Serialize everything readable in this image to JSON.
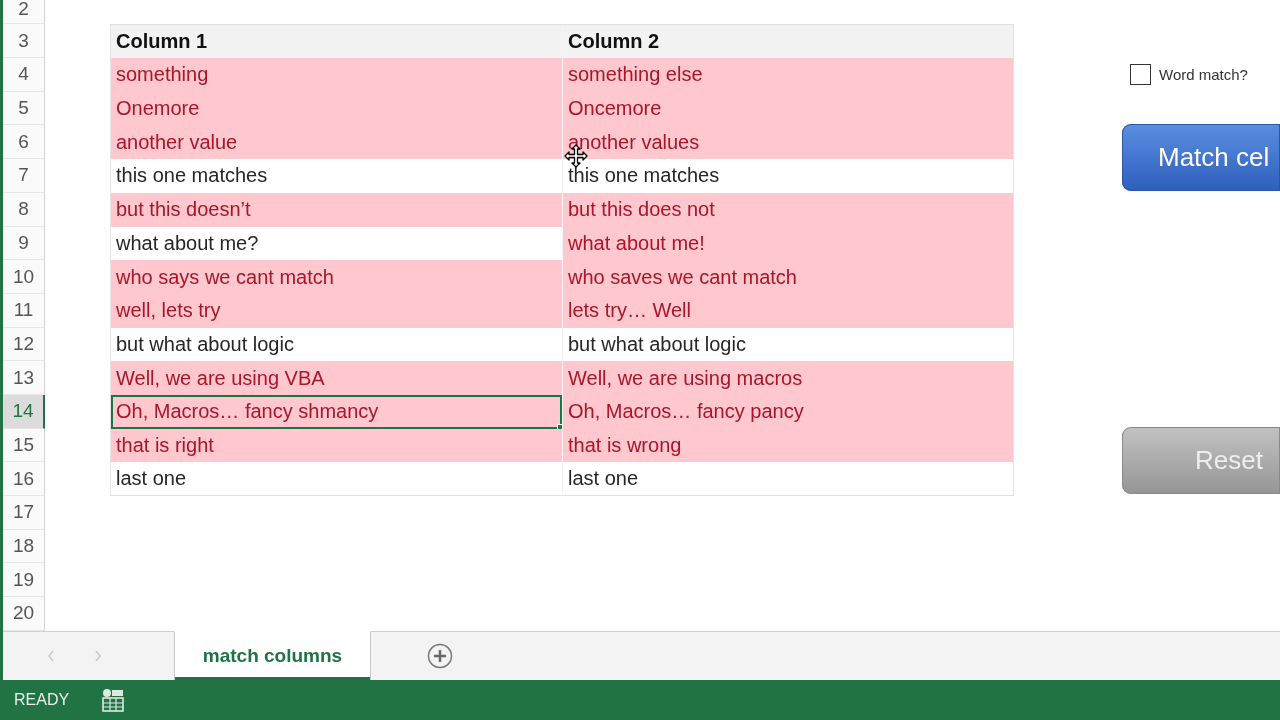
{
  "sheet": {
    "rows": [
      {
        "number": "2",
        "kind": "empty"
      },
      {
        "number": "3",
        "kind": "header",
        "cells": [
          {
            "text": "Column 1",
            "selected": false
          },
          {
            "text": "Column 2",
            "selected": false
          }
        ]
      },
      {
        "number": "4",
        "kind": "data",
        "cells": [
          {
            "text": "something",
            "highlighted": true,
            "selected": false
          },
          {
            "text": "something else",
            "highlighted": true,
            "selected": false
          }
        ]
      },
      {
        "number": "5",
        "kind": "data",
        "cells": [
          {
            "text": "Onemore",
            "highlighted": true,
            "selected": false
          },
          {
            "text": "Oncemore",
            "highlighted": true,
            "selected": false
          }
        ]
      },
      {
        "number": "6",
        "kind": "data",
        "cells": [
          {
            "text": "another value",
            "highlighted": true,
            "selected": false
          },
          {
            "text": "another values",
            "highlighted": true,
            "selected": false
          }
        ]
      },
      {
        "number": "7",
        "kind": "data",
        "cells": [
          {
            "text": "this one matches",
            "highlighted": false,
            "selected": false
          },
          {
            "text": "this one matches",
            "highlighted": false,
            "selected": false
          }
        ]
      },
      {
        "number": "8",
        "kind": "data",
        "cells": [
          {
            "text": "but this doesn’t",
            "highlighted": true,
            "selected": false
          },
          {
            "text": "but this does not",
            "highlighted": true,
            "selected": false
          }
        ]
      },
      {
        "number": "9",
        "kind": "data",
        "cells": [
          {
            "text": "what about me?",
            "highlighted": false,
            "selected": false
          },
          {
            "text": "what about me!",
            "highlighted": true,
            "selected": false
          }
        ]
      },
      {
        "number": "10",
        "kind": "data",
        "cells": [
          {
            "text": "who says we cant match",
            "highlighted": true,
            "selected": false
          },
          {
            "text": "who saves we cant match",
            "highlighted": true,
            "selected": false
          }
        ]
      },
      {
        "number": "11",
        "kind": "data",
        "cells": [
          {
            "text": "well, lets try",
            "highlighted": true,
            "selected": false
          },
          {
            "text": "lets try… Well",
            "highlighted": true,
            "selected": false
          }
        ]
      },
      {
        "number": "12",
        "kind": "data",
        "cells": [
          {
            "text": "but what about logic",
            "highlighted": false,
            "selected": false
          },
          {
            "text": "but what about logic",
            "highlighted": false,
            "selected": false
          }
        ]
      },
      {
        "number": "13",
        "kind": "data",
        "cells": [
          {
            "text": "Well, we are using VBA",
            "highlighted": true,
            "selected": false
          },
          {
            "text": "Well, we are using macros",
            "highlighted": true,
            "selected": false
          }
        ]
      },
      {
        "number": "14",
        "kind": "data",
        "cells": [
          {
            "text": "Oh, Macros… fancy shmancy",
            "highlighted": true,
            "selected": true
          },
          {
            "text": "Oh, Macros… fancy pancy",
            "highlighted": true,
            "selected": false
          }
        ]
      },
      {
        "number": "15",
        "kind": "data",
        "cells": [
          {
            "text": "that is right",
            "highlighted": true,
            "selected": false
          },
          {
            "text": "that is wrong",
            "highlighted": true,
            "selected": false
          }
        ]
      },
      {
        "number": "16",
        "kind": "data",
        "cells": [
          {
            "text": "last one",
            "highlighted": false,
            "selected": false
          },
          {
            "text": "last one",
            "highlighted": false,
            "selected": false
          }
        ]
      },
      {
        "number": "17",
        "kind": "empty"
      },
      {
        "number": "18",
        "kind": "empty"
      },
      {
        "number": "19",
        "kind": "empty"
      },
      {
        "number": "20",
        "kind": "empty"
      }
    ]
  },
  "controls": {
    "word_match": {
      "label": "Word match?",
      "checked": false
    },
    "buttons": [
      {
        "label": "Match cel",
        "kind": "primary"
      },
      {
        "label": "Reset",
        "kind": "secondary"
      }
    ]
  },
  "sheet_tabs": {
    "tabs": [
      {
        "label": "match columns",
        "selected": true
      }
    ]
  },
  "status_bar": {
    "mode": "READY"
  }
}
